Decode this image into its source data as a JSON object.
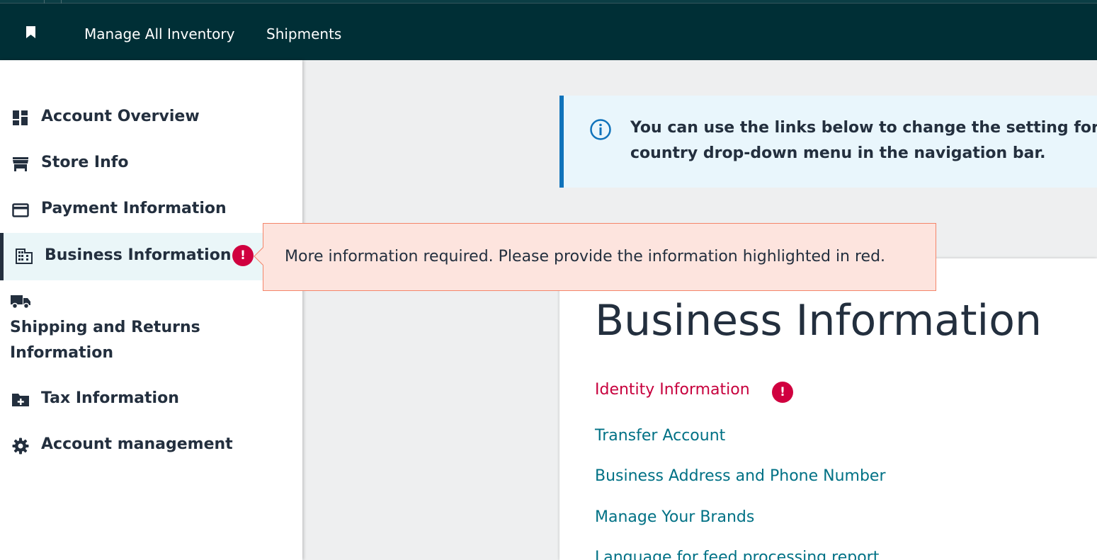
{
  "topbar": {
    "nav": [
      {
        "label": "Manage All Inventory"
      },
      {
        "label": "Shipments"
      }
    ]
  },
  "sidebar": {
    "items": [
      {
        "label": "Account Overview",
        "icon": "dashboard-icon"
      },
      {
        "label": "Store Info",
        "icon": "store-icon"
      },
      {
        "label": "Payment Information",
        "icon": "credit-card-icon"
      },
      {
        "label": "Business Information",
        "icon": "building-icon",
        "active": true,
        "alert": "!"
      },
      {
        "label": "Shipping and Returns Information",
        "icon": "truck-icon"
      },
      {
        "label": "Tax Information",
        "icon": "folder-plus-icon"
      },
      {
        "label": "Account management",
        "icon": "gear-icon"
      }
    ]
  },
  "banner": {
    "text_line1": "You can use the links below to change the setting for th",
    "text_line2": "country drop-down menu in the navigation bar."
  },
  "tooltip": {
    "message": "More information required. Please provide the information highlighted in red."
  },
  "main": {
    "title": "Business Information",
    "links": [
      {
        "label": "Identity Information",
        "error": true,
        "alert": "!"
      },
      {
        "label": "Transfer Account"
      },
      {
        "label": "Business Address and Phone Number"
      },
      {
        "label": "Manage Your Brands"
      },
      {
        "label": "Language for feed processing report"
      }
    ]
  },
  "colors": {
    "topbar": "#002f36",
    "link": "#007185",
    "error": "#d0003f",
    "info_accent": "#0f73bb"
  }
}
